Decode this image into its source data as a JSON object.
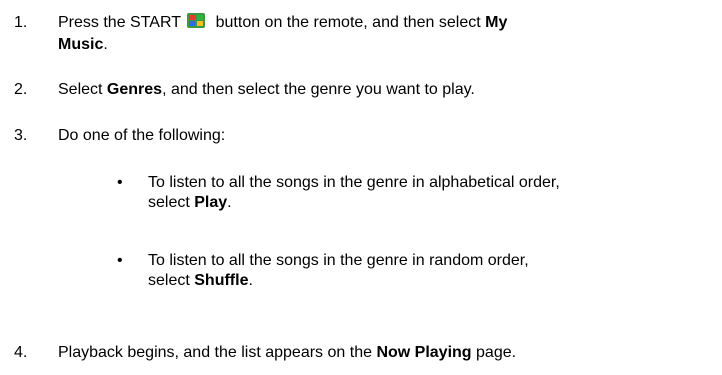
{
  "steps": [
    {
      "number": "1.",
      "pre": "Press the START",
      "mid": "button on the remote, and then select",
      "bold": "My",
      "line2_bold": "Music",
      "line2_end": "."
    },
    {
      "number": "2.",
      "pre": "Select",
      "bold": "Genres",
      "post": ", and then select the genre you want to play."
    },
    {
      "number": "3.",
      "text": "Do one of the following:"
    },
    {
      "number": "4.",
      "pre": "Playback begins, and the list appears on the",
      "bold": "Now Playing",
      "post": "page."
    }
  ],
  "bullets": [
    {
      "symbol": "•",
      "line1": "To listen to all the songs in the genre in alphabetical order,",
      "pre": "select",
      "bold": "Play",
      "post": "."
    },
    {
      "symbol": "•",
      "line1": "To listen to all the songs in the genre in random order,",
      "pre": "select",
      "bold": "Shuffle",
      "post": "."
    }
  ],
  "start_icon": {
    "name": "windows-start-icon",
    "colors": [
      "#e8392b",
      "#2fb24a",
      "#2a6fd8",
      "#f4c01e"
    ]
  }
}
